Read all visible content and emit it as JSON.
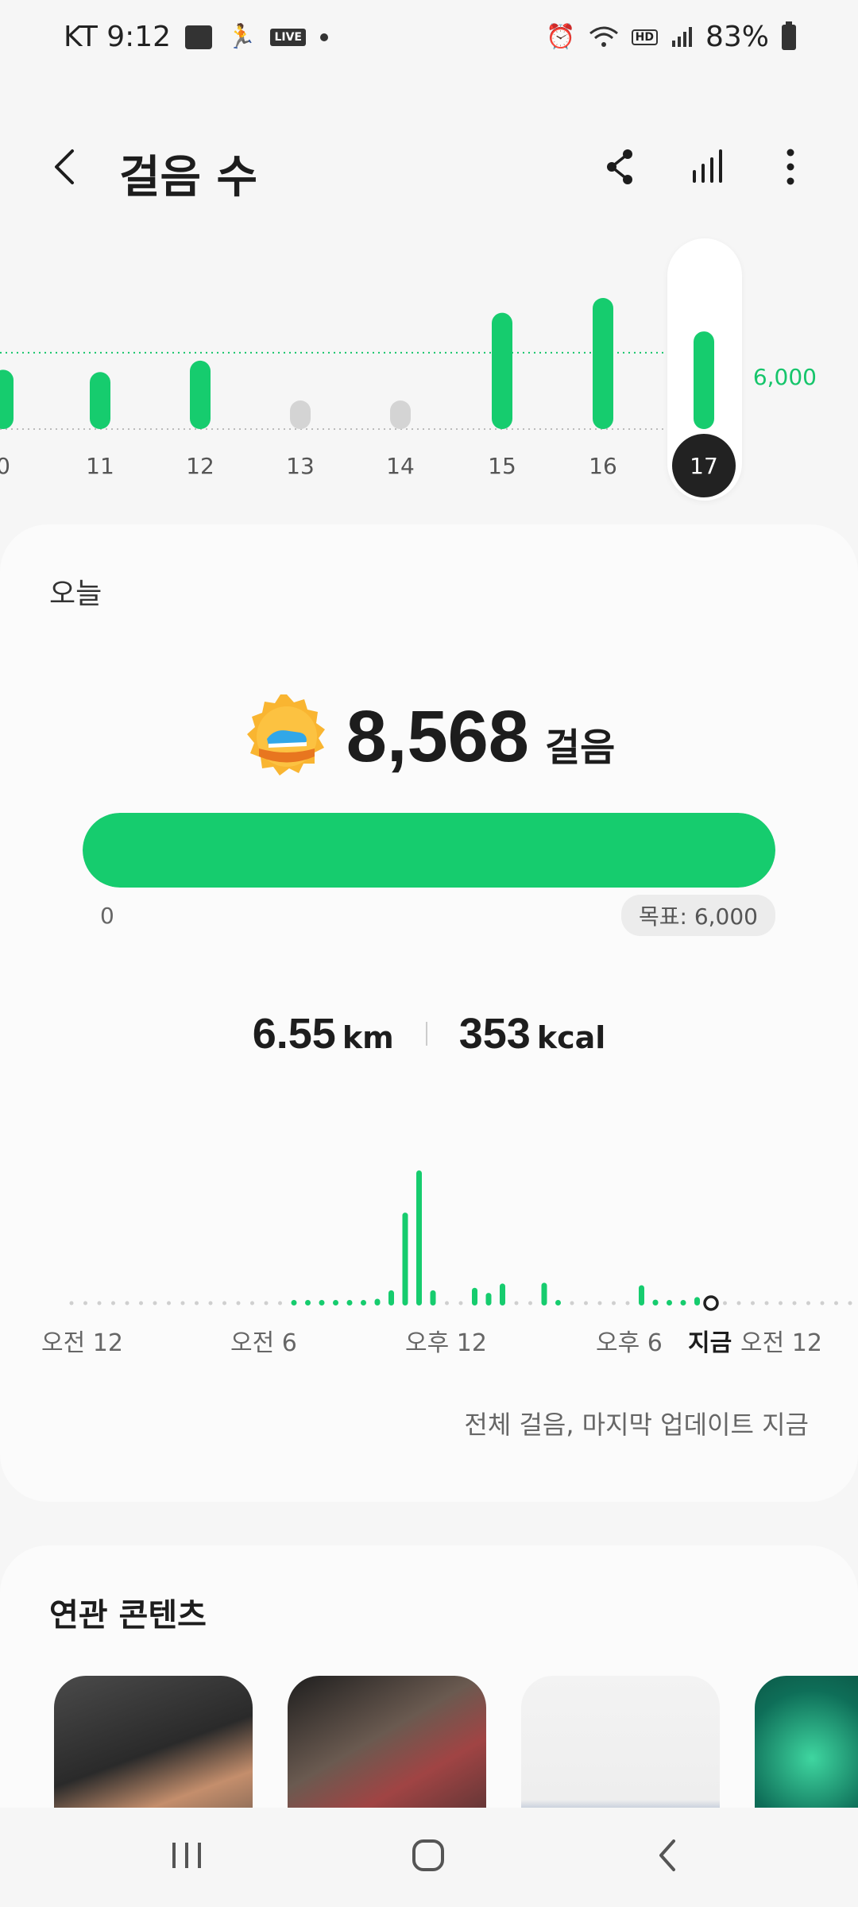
{
  "status_bar": {
    "carrier_time": "KT 9:12",
    "live_badge": "LIVE",
    "hd_badge": "HD",
    "battery": "83%"
  },
  "header": {
    "title": "걸음 수",
    "icons": [
      "back-icon",
      "share-icon",
      "bar-chart-icon",
      "more-vertical-icon"
    ]
  },
  "week_chart": {
    "days": [
      "0",
      "11",
      "12",
      "13",
      "14",
      "15",
      "16",
      "17"
    ],
    "values": [
      5200,
      5000,
      6000,
      1100,
      1050,
      10200,
      11500,
      8568
    ],
    "reached": [
      true,
      true,
      true,
      false,
      false,
      true,
      true,
      true
    ],
    "goal_label": "6,000",
    "selected_day": "17"
  },
  "today": {
    "label": "오늘",
    "steps": "8,568",
    "steps_unit": "걸음",
    "progress_fraction": 1.0,
    "progress_start": "0",
    "goal_pill": "목표: 6,000",
    "distance_value": "6.55",
    "distance_unit": "km",
    "calories_value": "353",
    "calories_unit": "kcal",
    "update_text": "전체 걸음, 마지막 업데이트 지금"
  },
  "chart_data": {
    "type": "bar",
    "title": "",
    "xlabel": "",
    "ylabel": "",
    "categories_labels": [
      "오전 12",
      "오전 6",
      "오후 12",
      "오후 6",
      "지금",
      "오전 12"
    ],
    "hourly_steps": [
      0,
      0,
      0,
      0,
      0,
      0,
      0,
      0,
      0,
      0,
      0,
      0,
      0,
      0,
      0,
      0,
      30,
      30,
      30,
      30,
      30,
      40,
      80,
      180,
      1100,
      1600,
      180,
      0,
      0,
      210,
      150,
      260,
      0,
      0,
      270,
      60,
      0,
      0,
      0,
      0,
      0,
      240,
      70,
      50,
      50,
      100,
      0,
      0,
      0,
      0,
      0,
      0,
      0,
      0,
      0,
      0,
      0
    ],
    "current_index": 46
  },
  "related": {
    "title": "연관 콘텐츠"
  },
  "navbar": {
    "icons": [
      "recent-apps-icon",
      "home-icon",
      "back-nav-icon"
    ]
  }
}
